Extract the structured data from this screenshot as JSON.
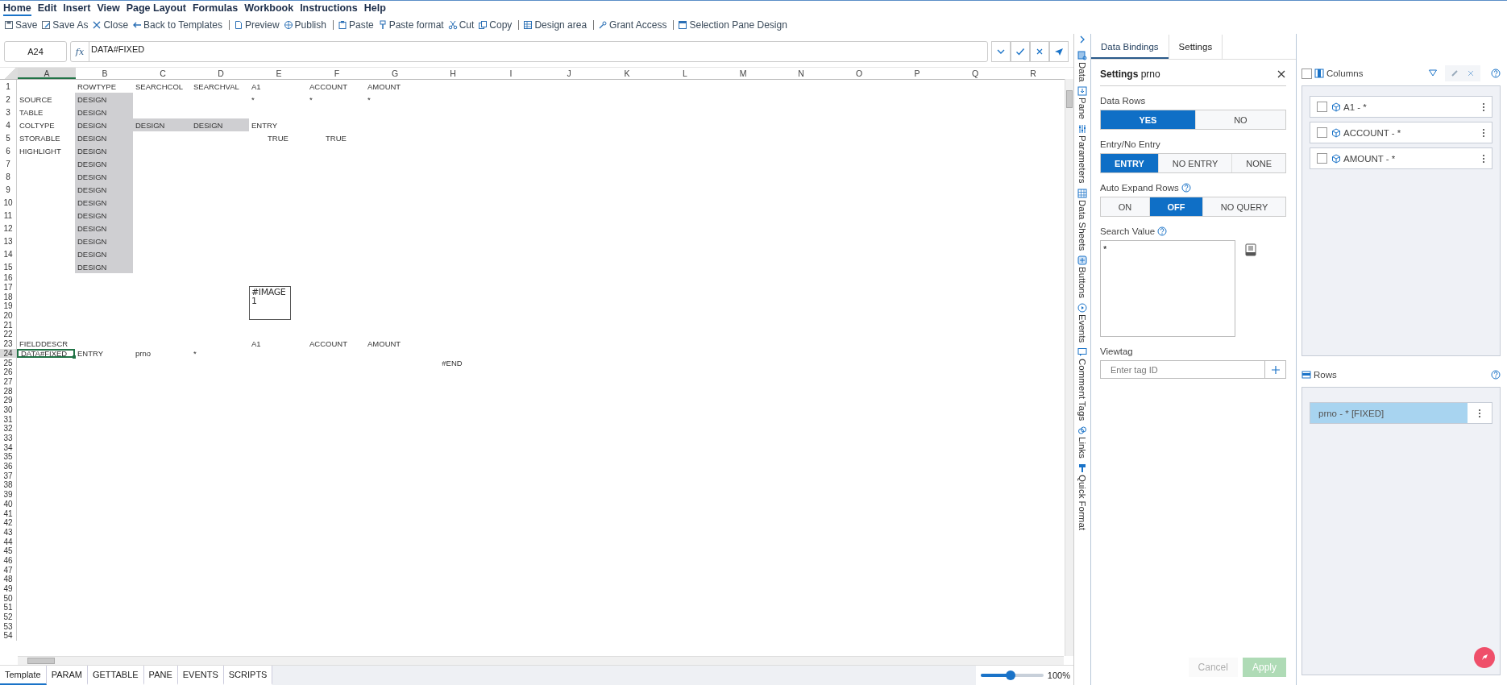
{
  "menu": [
    {
      "label": "Home",
      "selected": true
    },
    {
      "label": "Edit",
      "selected": false
    },
    {
      "label": "Insert",
      "selected": false
    },
    {
      "label": "View",
      "selected": false
    },
    {
      "label": "Page Layout",
      "selected": false
    },
    {
      "label": "Formulas",
      "selected": false
    },
    {
      "label": "Workbook",
      "selected": false
    },
    {
      "label": "Instructions",
      "selected": false
    },
    {
      "label": "Help",
      "selected": false
    }
  ],
  "toolbar": [
    [
      {
        "label": "Save",
        "kind": "save"
      },
      {
        "label": "Save As",
        "kind": "save-as"
      },
      {
        "label": "Close",
        "kind": "close"
      },
      {
        "label": "Back to Templates",
        "kind": "back"
      }
    ],
    [
      {
        "label": "Preview",
        "kind": "preview"
      },
      {
        "label": "Publish",
        "kind": "publish"
      }
    ],
    [
      {
        "label": "Paste",
        "kind": "paste"
      },
      {
        "label": "Paste format",
        "kind": "format"
      },
      {
        "label": "Cut",
        "kind": "cut"
      },
      {
        "label": "Copy",
        "kind": "copy"
      }
    ],
    [
      {
        "label": "Design area",
        "kind": "design"
      }
    ],
    [
      {
        "label": "Grant Access",
        "kind": "access"
      }
    ],
    [
      {
        "label": "Selection Pane Design",
        "kind": "pane"
      }
    ]
  ],
  "formula_bar": {
    "name_box": "A24",
    "function_label": "fx",
    "value": "DATA#FIXED"
  },
  "sheet": {
    "columns": [
      {
        "label": "A",
        "selected": true
      },
      {
        "label": "B",
        "selected": false
      },
      {
        "label": "C",
        "selected": false
      },
      {
        "label": "D",
        "selected": false
      },
      {
        "label": "E",
        "selected": false
      },
      {
        "label": "F",
        "selected": false
      },
      {
        "label": "G",
        "selected": false
      },
      {
        "label": "H",
        "selected": false
      },
      {
        "label": "I",
        "selected": false
      },
      {
        "label": "J",
        "selected": false
      },
      {
        "label": "K",
        "selected": false
      },
      {
        "label": "L",
        "selected": false
      },
      {
        "label": "M",
        "selected": false
      },
      {
        "label": "N",
        "selected": false
      },
      {
        "label": "O",
        "selected": false
      },
      {
        "label": "P",
        "selected": false
      },
      {
        "label": "Q",
        "selected": false
      },
      {
        "label": "R",
        "selected": false
      }
    ],
    "rows": [
      {
        "number": "1",
        "selected": false,
        "cells": [
          {},
          {
            "text": "ROWTYPE",
            "shaded": false,
            "centered": false,
            "selected": false
          },
          {
            "text": "SEARCHCOL",
            "shaded": false,
            "centered": false,
            "selected": false
          },
          {
            "text": "SEARCHVAL",
            "shaded": false,
            "centered": false,
            "selected": false
          },
          {
            "text": "A1",
            "shaded": false,
            "centered": false,
            "selected": false
          },
          {
            "text": "ACCOUNT",
            "shaded": false,
            "centered": false,
            "selected": false
          },
          {
            "text": "AMOUNT",
            "shaded": false,
            "centered": false,
            "selected": false
          }
        ]
      },
      {
        "number": "2",
        "selected": false,
        "cells": [
          {
            "text": "SOURCE",
            "shaded": false,
            "centered": false,
            "selected": false
          },
          {
            "text": "DESIGN",
            "shaded": true,
            "centered": false,
            "selected": false
          },
          {},
          {},
          {
            "text": "*",
            "shaded": false,
            "centered": false,
            "selected": false
          },
          {
            "text": "*",
            "shaded": false,
            "centered": false,
            "selected": false
          },
          {
            "text": "*",
            "shaded": false,
            "centered": false,
            "selected": false
          }
        ]
      },
      {
        "number": "3",
        "selected": false,
        "cells": [
          {
            "text": "TABLE",
            "shaded": false,
            "centered": false,
            "selected": false
          },
          {
            "text": "DESIGN",
            "shaded": true,
            "centered": false,
            "selected": false
          }
        ]
      },
      {
        "number": "4",
        "selected": false,
        "cells": [
          {
            "text": "COLTYPE",
            "shaded": false,
            "centered": false,
            "selected": false
          },
          {
            "text": "DESIGN",
            "shaded": true,
            "centered": false,
            "selected": false
          },
          {
            "text": "DESIGN",
            "shaded": true,
            "centered": false,
            "selected": false
          },
          {
            "text": "DESIGN",
            "shaded": true,
            "centered": false,
            "selected": false
          },
          {
            "text": "ENTRY",
            "shaded": false,
            "centered": false,
            "selected": false
          }
        ]
      },
      {
        "number": "5",
        "selected": false,
        "cells": [
          {
            "text": "STORABLE",
            "shaded": false,
            "centered": false,
            "selected": false
          },
          {
            "text": "DESIGN",
            "shaded": true,
            "centered": false,
            "selected": false
          },
          {},
          {},
          {
            "text": "TRUE",
            "shaded": false,
            "centered": true,
            "selected": false
          },
          {
            "text": "TRUE",
            "shaded": false,
            "centered": true,
            "selected": false
          }
        ]
      },
      {
        "number": "6",
        "selected": false,
        "cells": [
          {
            "text": "HIGHLIGHT",
            "shaded": false,
            "centered": false,
            "selected": false
          },
          {
            "text": "DESIGN",
            "shaded": true,
            "centered": false,
            "selected": false
          }
        ]
      },
      {
        "number": "7",
        "selected": false,
        "cells": [
          {},
          {
            "text": "DESIGN",
            "shaded": true,
            "centered": false,
            "selected": false
          }
        ]
      },
      {
        "number": "8",
        "selected": false,
        "cells": [
          {},
          {
            "text": "DESIGN",
            "shaded": true,
            "centered": false,
            "selected": false
          }
        ]
      },
      {
        "number": "9",
        "selected": false,
        "cells": [
          {},
          {
            "text": "DESIGN",
            "shaded": true,
            "centered": false,
            "selected": false
          }
        ]
      },
      {
        "number": "10",
        "selected": false,
        "cells": [
          {},
          {
            "text": "DESIGN",
            "shaded": true,
            "centered": false,
            "selected": false
          }
        ]
      },
      {
        "number": "11",
        "selected": false,
        "cells": [
          {},
          {
            "text": "DESIGN",
            "shaded": true,
            "centered": false,
            "selected": false
          }
        ]
      },
      {
        "number": "12",
        "selected": false,
        "cells": [
          {},
          {
            "text": "DESIGN",
            "shaded": true,
            "centered": false,
            "selected": false
          }
        ]
      },
      {
        "number": "13",
        "selected": false,
        "cells": [
          {},
          {
            "text": "DESIGN",
            "shaded": true,
            "centered": false,
            "selected": false
          }
        ]
      },
      {
        "number": "14",
        "selected": false,
        "cells": [
          {},
          {
            "text": "DESIGN",
            "shaded": true,
            "centered": false,
            "selected": false
          }
        ]
      },
      {
        "number": "15",
        "selected": false,
        "cells": [
          {},
          {
            "text": "DESIGN",
            "shaded": true,
            "centered": false,
            "selected": false
          }
        ]
      },
      {
        "number": "16",
        "selected": false
      },
      {
        "number": "17",
        "selected": false
      },
      {
        "number": "18",
        "selected": false
      },
      {
        "number": "19",
        "selected": false
      },
      {
        "number": "20",
        "selected": false
      },
      {
        "number": "21",
        "selected": false
      },
      {
        "number": "22",
        "selected": false
      },
      {
        "number": "23",
        "selected": false,
        "cells": [
          {
            "text": "FIELDDESCR",
            "shaded": false,
            "centered": false,
            "selected": false
          },
          {},
          {},
          {},
          {
            "text": "A1",
            "shaded": false,
            "centered": false,
            "selected": false
          },
          {
            "text": "ACCOUNT",
            "shaded": false,
            "centered": false,
            "selected": false
          },
          {
            "text": "AMOUNT",
            "shaded": false,
            "centered": false,
            "selected": false
          }
        ]
      },
      {
        "number": "24",
        "selected": true,
        "cells": [
          {
            "text": "DATA#FIXED",
            "shaded": false,
            "centered": false,
            "selected": true
          },
          {
            "text": "ENTRY",
            "shaded": false,
            "centered": false,
            "selected": false
          },
          {
            "text": "prno",
            "shaded": false,
            "centered": false,
            "selected": false
          },
          {
            "text": "*",
            "shaded": false,
            "centered": false,
            "selected": false
          }
        ]
      },
      {
        "number": "25",
        "selected": false,
        "cells": [
          {},
          {},
          {},
          {},
          {},
          {},
          {},
          {
            "text": "#END",
            "shaded": false,
            "centered": true,
            "selected": false
          }
        ]
      },
      {
        "number": "26",
        "selected": false
      },
      {
        "number": "27",
        "selected": false
      },
      {
        "number": "28",
        "selected": false
      },
      {
        "number": "29",
        "selected": false
      },
      {
        "number": "30",
        "selected": false
      },
      {
        "number": "31",
        "selected": false
      },
      {
        "number": "32",
        "selected": false
      },
      {
        "number": "33",
        "selected": false
      },
      {
        "number": "34",
        "selected": false
      },
      {
        "number": "35",
        "selected": false
      },
      {
        "number": "36",
        "selected": false
      },
      {
        "number": "37",
        "selected": false
      },
      {
        "number": "38",
        "selected": false
      },
      {
        "number": "39",
        "selected": false
      },
      {
        "number": "40",
        "selected": false
      },
      {
        "number": "41",
        "selected": false
      },
      {
        "number": "42",
        "selected": false
      },
      {
        "number": "43",
        "selected": false
      },
      {
        "number": "44",
        "selected": false
      },
      {
        "number": "45",
        "selected": false
      },
      {
        "number": "46",
        "selected": false
      },
      {
        "number": "47",
        "selected": false
      },
      {
        "number": "48",
        "selected": false
      },
      {
        "number": "49",
        "selected": false
      },
      {
        "number": "50",
        "selected": false
      },
      {
        "number": "51",
        "selected": false
      },
      {
        "number": "52",
        "selected": false
      },
      {
        "number": "53",
        "selected": false
      },
      {
        "number": "54",
        "selected": false
      }
    ],
    "image": {
      "text": "#IMAGE 1"
    }
  },
  "sheet_tabs": [
    {
      "label": "Template",
      "selected": true
    },
    {
      "label": "PARAM",
      "selected": false
    },
    {
      "label": "GETTABLE",
      "selected": false
    },
    {
      "label": "PANE",
      "selected": false
    },
    {
      "label": "EVENTS",
      "selected": false
    },
    {
      "label": "SCRIPTS",
      "selected": false
    }
  ],
  "zoom": {
    "level": 0.47,
    "reading": "100%"
  },
  "side_strip": [
    {
      "label": "Data",
      "kind": "data"
    },
    {
      "label": "Pane",
      "kind": "pane"
    },
    {
      "label": "Parameters",
      "kind": "parameters"
    },
    {
      "label": "Data Sheets",
      "kind": "sheets"
    },
    {
      "label": "Buttons",
      "kind": "buttons"
    },
    {
      "label": "Events",
      "kind": "events"
    },
    {
      "label": "Comment Tags",
      "kind": "comments"
    },
    {
      "label": "Links",
      "kind": "links"
    },
    {
      "label": "Quick Format",
      "kind": "format"
    }
  ],
  "settings_panel": {
    "tabs": [
      {
        "label": "Data Bindings",
        "selected": true
      },
      {
        "label": "Settings",
        "selected": false
      }
    ],
    "title": "**Settings** prno",
    "groups": [
      {
        "label": "Data Rows",
        "help": false,
        "options": [
          {
            "label": "YES",
            "selected": true
          },
          {
            "label": "NO",
            "selected": false
          }
        ]
      },
      {
        "label": "Entry/No Entry",
        "help": false,
        "options": [
          {
            "label": "ENTRY",
            "selected": true
          },
          {
            "label": "NO ENTRY",
            "selected": false
          },
          {
            "label": "NONE",
            "selected": false
          }
        ]
      },
      {
        "label": "Auto Expand Rows",
        "help": true,
        "options": [
          {
            "label": "ON",
            "selected": false
          },
          {
            "label": "OFF",
            "selected": true
          },
          {
            "label": "NO QUERY",
            "selected": false
          }
        ]
      }
    ],
    "search_value": {
      "label": "Search Value",
      "help": true,
      "value": "*"
    },
    "viewtag": {
      "label": "Viewtag",
      "placeholder": "Enter tag ID"
    },
    "buttons": [
      {
        "label": "Cancel",
        "kind": "secondary",
        "disabled": true
      },
      {
        "label": "Apply",
        "kind": "primary",
        "disabled": true
      }
    ]
  },
  "bindings": {
    "columns": {
      "label": "Columns",
      "checked": false,
      "items": [
        {
          "label": "A1 - *",
          "checked": false
        },
        {
          "label": "ACCOUNT - *",
          "checked": false
        },
        {
          "label": "AMOUNT - *",
          "checked": false
        }
      ]
    },
    "rows": {
      "label": "Rows",
      "items": [
        {
          "label": "prno - * [FIXED]",
          "selected": true
        }
      ]
    }
  }
}
